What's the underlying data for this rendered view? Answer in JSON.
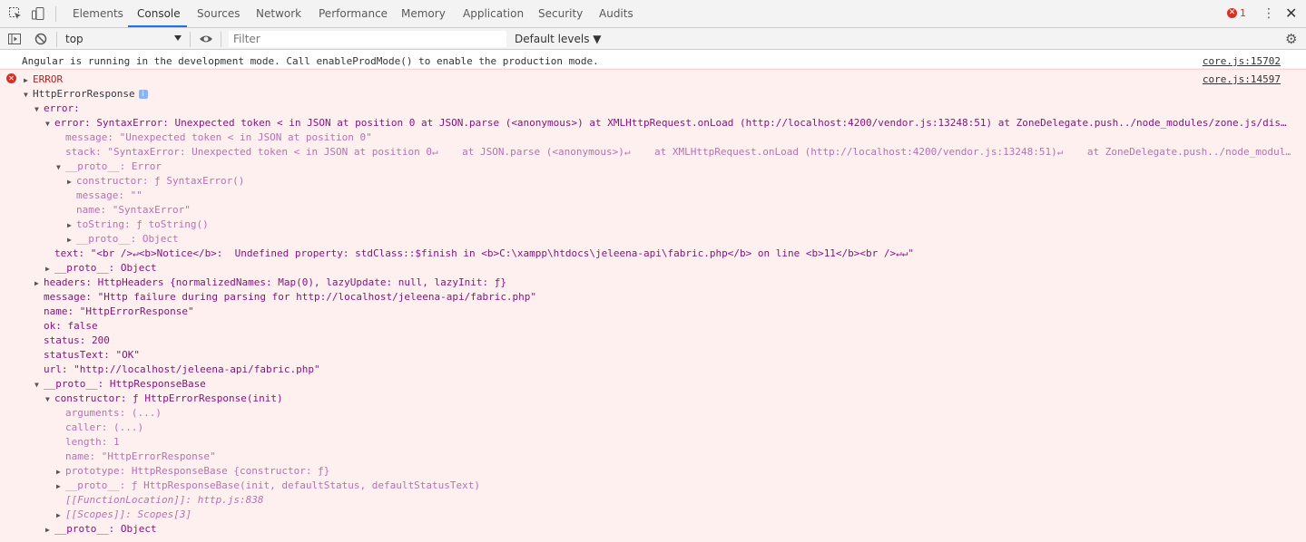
{
  "tabs": [
    "Elements",
    "Console",
    "Sources",
    "Network",
    "Performance",
    "Memory",
    "Application",
    "Security",
    "Audits"
  ],
  "active_tab": "Console",
  "error_count": "1",
  "toolbar": {
    "context": "top",
    "filter_placeholder": "Filter",
    "levels": "Default levels ▼"
  },
  "console": {
    "info_message": "Angular is running in the development mode. Call enableProdMode() to enable the production mode.",
    "info_source": "core.js:15702",
    "error_source": "core.js:14597",
    "error_label": "ERROR",
    "lines": [
      "HttpErrorResponse",
      "error:",
      "error: SyntaxError: Unexpected token < in JSON at position 0 at JSON.parse (<anonymous>) at XMLHttpRequest.onLoad (http://localhost:4200/vendor.js:13248:51) at ZoneDelegate.push../node_modules/zone.js/dis…",
      "message: \"Unexpected token < in JSON at position 0\"",
      "stack: \"SyntaxError: Unexpected token < in JSON at position 0↵    at JSON.parse (<anonymous>)↵    at XMLHttpRequest.onLoad (http://localhost:4200/vendor.js:13248:51)↵    at ZoneDelegate.push../node_modul…",
      "__proto__: Error",
      "constructor: ƒ SyntaxError()",
      "message: \"\"",
      "name: \"SyntaxError\"",
      "toString: ƒ toString()",
      "__proto__: Object",
      "text: \"<br />↵<b>Notice</b>:  Undefined property: stdClass::$finish in <b>C:\\xampp\\htdocs\\jeleena-api\\fabric.php</b> on line <b>11</b><br />↵↵\"",
      "__proto__: Object",
      "headers: HttpHeaders {normalizedNames: Map(0), lazyUpdate: null, lazyInit: ƒ}",
      "message: \"Http failure during parsing for http://localhost/jeleena-api/fabric.php\"",
      "name: \"HttpErrorResponse\"",
      "ok: false",
      "status: 200",
      "statusText: \"OK\"",
      "url: \"http://localhost/jeleena-api/fabric.php\"",
      "__proto__: HttpResponseBase",
      "constructor: ƒ HttpErrorResponse(init)",
      "arguments: (...)",
      "caller: (...)",
      "length: 1",
      "name: \"HttpErrorResponse\"",
      "prototype: HttpResponseBase {constructor: ƒ}",
      "__proto__: ƒ HttpResponseBase(init, defaultStatus, defaultStatusText)",
      "[[FunctionLocation]]: http.js:838",
      "[[Scopes]]: Scopes[3]",
      "__proto__: Object"
    ]
  }
}
